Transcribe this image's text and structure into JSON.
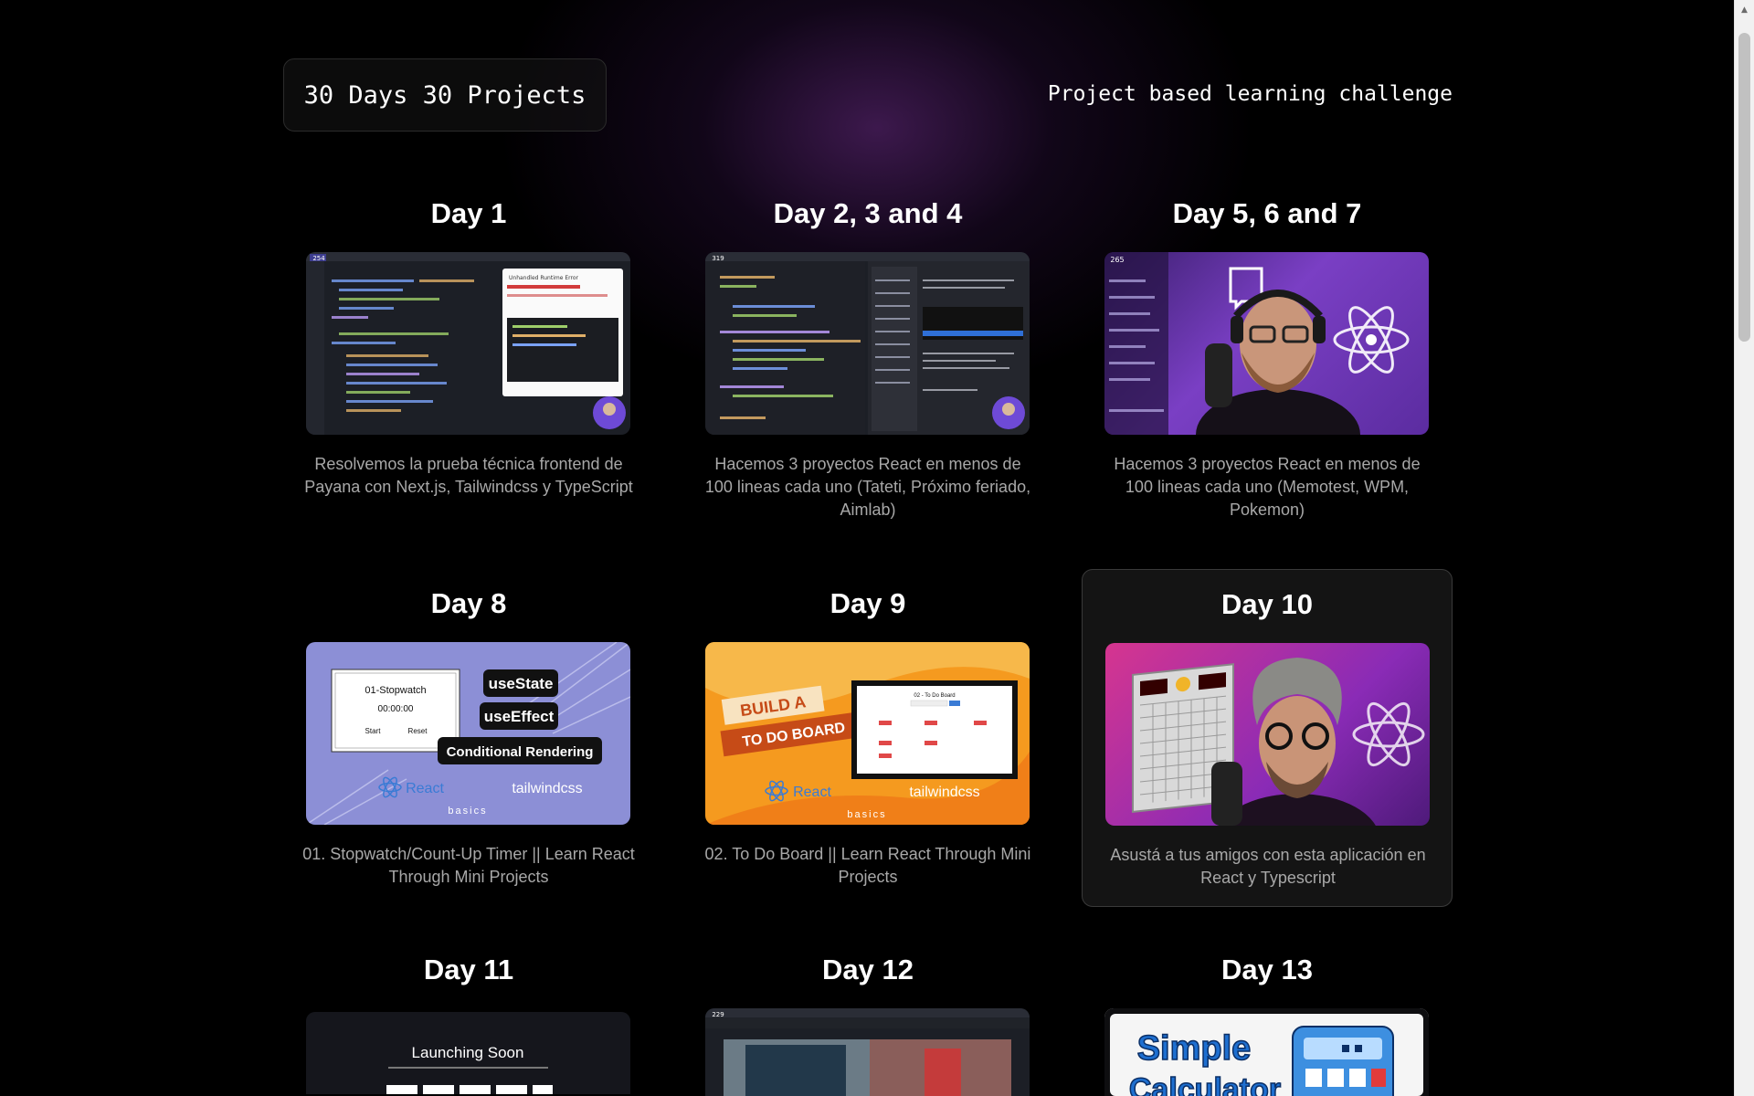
{
  "header": {
    "logo": "30 Days 30 Projects",
    "tagline": "Project based learning challenge"
  },
  "days": [
    {
      "title": "Day 1",
      "description": "Resolvemos la prueba técnica frontend de Payana con Next.js, Tailwindcss y TypeScript",
      "thumb": {
        "type": "code",
        "badge": "254",
        "caption": "Unhandled Runtime Error"
      }
    },
    {
      "title": "Day 2, 3 and 4",
      "description": "Hacemos 3 proyectos React en menos de 100 lineas cada uno (Tateti, Próximo feriado, Aimlab)",
      "thumb": {
        "type": "code",
        "badge": "319"
      }
    },
    {
      "title": "Day 5, 6 and 7",
      "description": "Hacemos 3 proyectos React en menos de 100 lineas cada uno (Memotest, WPM, Pokemon)",
      "thumb": {
        "type": "streamer",
        "badge": "265"
      }
    },
    {
      "title": "Day 8",
      "description": "01. Stopwatch/Count-Up Timer || Learn React Through Mini Projects",
      "thumb": {
        "type": "stopwatch",
        "app_title": "01-Stopwatch",
        "time": "00:00:00",
        "start": "Start",
        "reset": "Reset",
        "tags": [
          "useState",
          "useEffect",
          "Conditional Rendering"
        ],
        "react": "React",
        "tailwind": "tailwindcss",
        "basics": "basics"
      }
    },
    {
      "title": "Day 9",
      "description": "02. To Do Board || Learn React Through Mini Projects",
      "thumb": {
        "type": "todo",
        "line1": "BUILD A",
        "line2": "TO DO BOARD",
        "board_title": "02 - To Do Board",
        "react": "React",
        "tailwind": "tailwindcss",
        "basics": "basics"
      }
    },
    {
      "title": "Day 10",
      "description": "Asustá a tus amigos con esta aplicación en React y Typescript",
      "thumb": {
        "type": "streamer2"
      }
    },
    {
      "title": "Day 11",
      "description": "",
      "thumb": {
        "type": "launch",
        "heading": "Launching Soon"
      }
    },
    {
      "title": "Day 12",
      "description": "",
      "thumb": {
        "type": "code",
        "badge": "229"
      }
    },
    {
      "title": "Day 13",
      "description": "",
      "thumb": {
        "type": "calculator",
        "word1": "Simple",
        "word2": "Calculator"
      }
    }
  ],
  "colors": {
    "background": "#000000",
    "glow": "#6e2d8c",
    "card_selected_bg": "#141414",
    "description_text": "#a8a8a8"
  }
}
